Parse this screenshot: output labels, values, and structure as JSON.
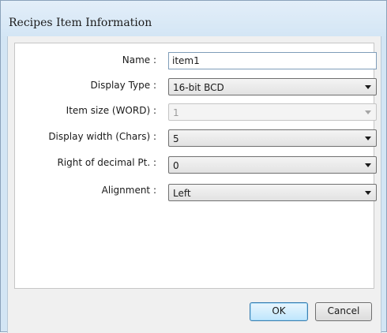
{
  "window": {
    "title": "Recipes Item Information"
  },
  "form": {
    "name": {
      "label": "Name :",
      "value": "item1"
    },
    "display_type": {
      "label": "Display Type :",
      "value": "16-bit BCD"
    },
    "item_size": {
      "label": "Item size (WORD) :",
      "value": "1",
      "enabled": false
    },
    "display_width": {
      "label": "Display width (Chars) :",
      "value": "5"
    },
    "decimal": {
      "label": "Right of decimal Pt. :",
      "value": "0"
    },
    "alignment": {
      "label": "Alignment :",
      "value": "Left"
    }
  },
  "buttons": {
    "ok_label": "OK",
    "cancel_label": "Cancel"
  },
  "colors": {
    "frame": "#d3e5f4",
    "panel": "#ffffff",
    "body": "#f0f0f0",
    "default_button_border": "#3c7fb1"
  },
  "icons": {
    "combo_arrow": "chevron-down-icon"
  }
}
